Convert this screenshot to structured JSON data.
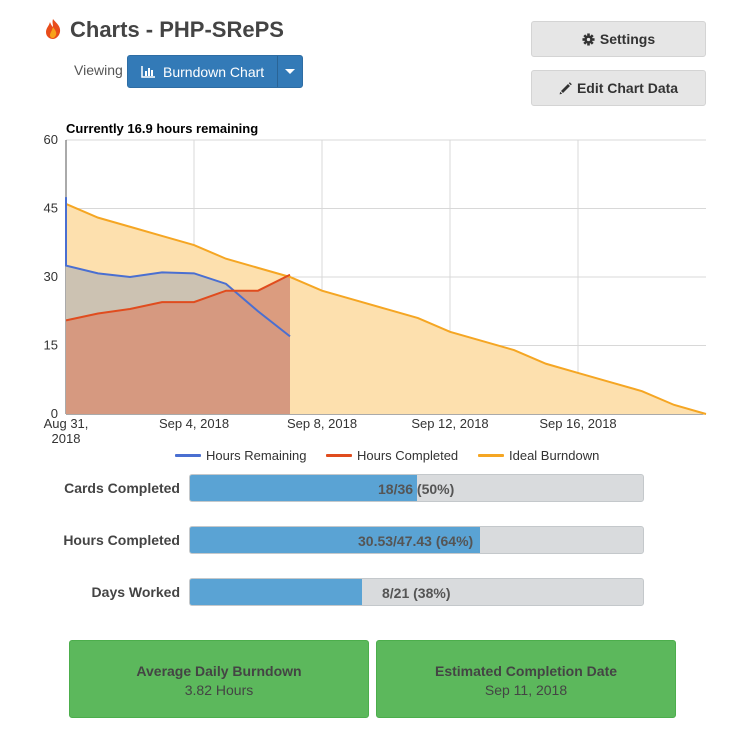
{
  "header": {
    "title": "Charts - PHP-SRePS",
    "viewing_label": "Viewing",
    "chart_selector_label": "Burndown Chart",
    "settings_label": "Settings",
    "edit_chart_label": "Edit Chart Data"
  },
  "colors": {
    "primary": "#337ab7",
    "remaining": "#4a6fd1",
    "completed": "#e04c1e",
    "ideal": "#f5a623",
    "progress": "#5aa3d4",
    "card": "#5cb85c"
  },
  "chart_data": {
    "type": "line",
    "title": "Currently 16.9 hours remaining",
    "x_ticks": [
      "Aug 31, 2018",
      "Sep 4, 2018",
      "Sep 8, 2018",
      "Sep 12, 2018",
      "Sep 16, 2018"
    ],
    "x_range": [
      "2018-08-31",
      "2018-09-20"
    ],
    "ylim": [
      0,
      60
    ],
    "y_ticks": [
      0,
      15,
      30,
      45,
      60
    ],
    "grid": true,
    "legend_position": "bottom",
    "series": [
      {
        "name": "Hours Remaining",
        "color": "#4a6fd1",
        "fill": "#c7bfb3",
        "points": [
          [
            "2018-08-31",
            47.5
          ],
          [
            "2018-08-31",
            32.5
          ],
          [
            "2018-09-01",
            30.8
          ],
          [
            "2018-09-02",
            30.0
          ],
          [
            "2018-09-03",
            31.0
          ],
          [
            "2018-09-04",
            30.8
          ],
          [
            "2018-09-05",
            28.5
          ],
          [
            "2018-09-06",
            22.5
          ],
          [
            "2018-09-07",
            17.0
          ]
        ]
      },
      {
        "name": "Hours Completed",
        "color": "#e04c1e",
        "fill": "#d7957a",
        "points": [
          [
            "2018-08-31",
            20.5
          ],
          [
            "2018-09-01",
            22.0
          ],
          [
            "2018-09-02",
            23.0
          ],
          [
            "2018-09-03",
            24.5
          ],
          [
            "2018-09-04",
            24.5
          ],
          [
            "2018-09-05",
            27.0
          ],
          [
            "2018-09-06",
            27.0
          ],
          [
            "2018-09-07",
            30.5
          ]
        ]
      },
      {
        "name": "Ideal Burndown",
        "color": "#f5a623",
        "fill": "#fde0ae",
        "points": [
          [
            "2018-08-31",
            46.0
          ],
          [
            "2018-09-01",
            43.0
          ],
          [
            "2018-09-02",
            41.0
          ],
          [
            "2018-09-03",
            39.0
          ],
          [
            "2018-09-04",
            37.0
          ],
          [
            "2018-09-05",
            34.0
          ],
          [
            "2018-09-06",
            32.0
          ],
          [
            "2018-09-07",
            30.0
          ],
          [
            "2018-09-08",
            27.0
          ],
          [
            "2018-09-09",
            25.0
          ],
          [
            "2018-09-10",
            23.0
          ],
          [
            "2018-09-11",
            21.0
          ],
          [
            "2018-09-12",
            18.0
          ],
          [
            "2018-09-13",
            16.0
          ],
          [
            "2018-09-14",
            14.0
          ],
          [
            "2018-09-15",
            11.0
          ],
          [
            "2018-09-16",
            9.0
          ],
          [
            "2018-09-17",
            7.0
          ],
          [
            "2018-09-18",
            5.0
          ],
          [
            "2018-09-19",
            2.0
          ],
          [
            "2018-09-20",
            0.0
          ]
        ]
      }
    ]
  },
  "stats": [
    {
      "label": "Cards Completed",
      "text": "18/36 (50%)",
      "fraction": 0.5
    },
    {
      "label": "Hours Completed",
      "text": "30.53/47.43 (64%)",
      "fraction": 0.64
    },
    {
      "label": "Days Worked",
      "text": "8/21 (38%)",
      "fraction": 0.38
    }
  ],
  "cards": [
    {
      "title": "Average Daily Burndown",
      "value": "3.82 Hours"
    },
    {
      "title": "Estimated Completion Date",
      "value": "Sep 11, 2018"
    }
  ]
}
